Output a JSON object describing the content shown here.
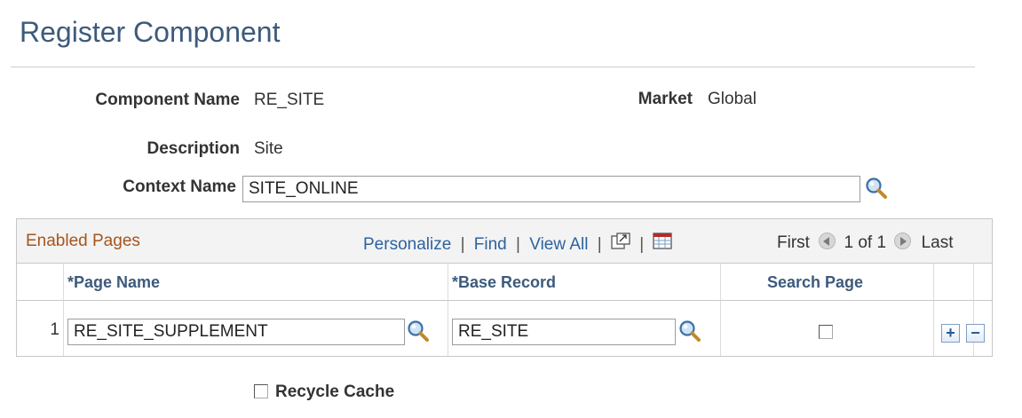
{
  "page": {
    "title": "Register Component"
  },
  "fields": {
    "component_name_label": "Component Name",
    "component_name_value": "RE_SITE",
    "market_label": "Market",
    "market_value": "Global",
    "description_label": "Description",
    "description_value": "Site",
    "context_name_label": "Context Name",
    "context_name_value": "SITE_ONLINE"
  },
  "grid": {
    "title": "Enabled Pages",
    "personalize": "Personalize",
    "find": "Find",
    "view_all": "View All",
    "separator": "|",
    "first": "First",
    "range": "1 of 1",
    "last": "Last",
    "columns": {
      "page_name": "*Page Name",
      "base_record": "*Base Record",
      "search_page": "Search Page"
    },
    "rows": [
      {
        "num": "1",
        "page_name": "RE_SITE_SUPPLEMENT",
        "base_record": "RE_SITE",
        "search_page": false
      }
    ],
    "add_label": "+",
    "delete_label": "−"
  },
  "recycle_cache": {
    "label": "Recycle Cache",
    "checked": false
  },
  "icons": {
    "lookup": "magnifier-lookup-icon",
    "zoom": "new-window-icon",
    "download": "spreadsheet-icon"
  },
  "colors": {
    "title": "#3d5a7c",
    "grid_title": "#a5551d",
    "link": "#2c63a0"
  }
}
